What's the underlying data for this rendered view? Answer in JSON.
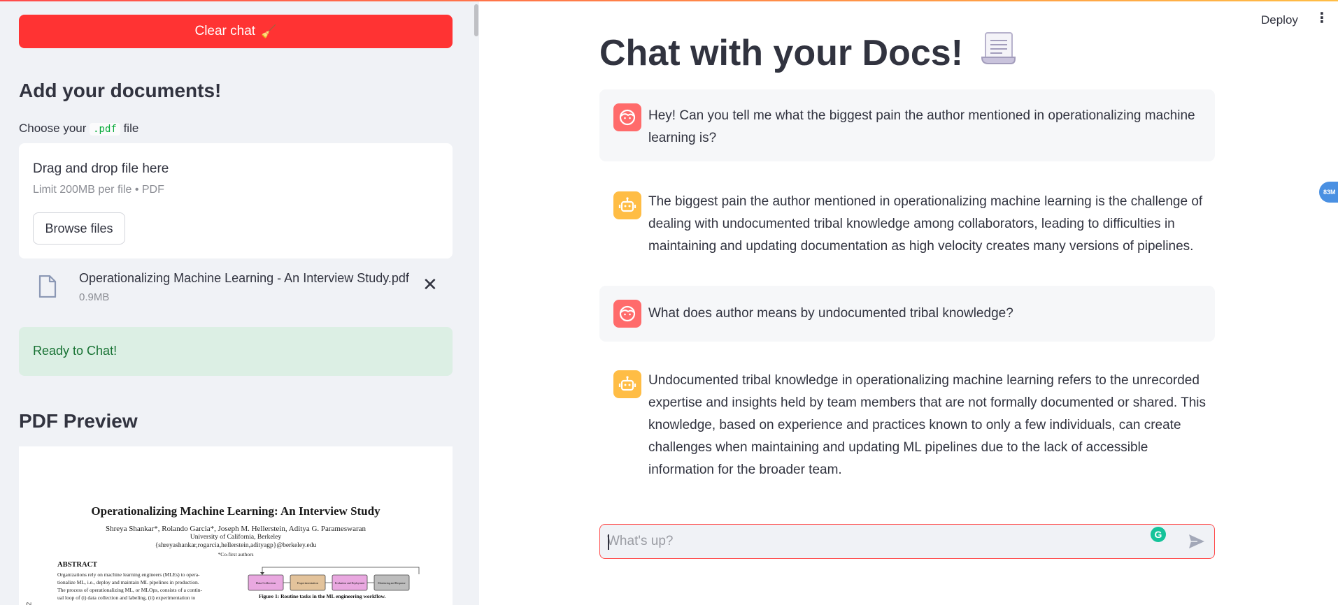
{
  "sidebar": {
    "clear_button": "Clear chat",
    "clear_button_icon": "🧹",
    "heading": "Add your documents!",
    "choose_prefix": "Choose your",
    "choose_code": ".pdf",
    "choose_suffix": "file",
    "dropzone": {
      "title": "Drag and drop file here",
      "subtitle": "Limit 200MB per file • PDF",
      "browse_button": "Browse files"
    },
    "uploaded_file": {
      "name": "Operationalizing Machine Learning - An Interview Study.pdf",
      "size": "0.9MB"
    },
    "status": "Ready to Chat!",
    "preview_heading": "PDF Preview",
    "pdf": {
      "title": "Operationalizing Machine Learning: An Interview Study",
      "authors": "Shreya Shankar*, Rolando Garcia*, Joseph M. Hellerstein, Aditya G. Parameswaran",
      "university": "University of California, Berkeley",
      "emails": "{shreyashankar,rogarcia,hellerstein,adityagp}@berkeley.edu",
      "cofirst": "*Co-first authors",
      "abstract_heading": "ABSTRACT",
      "abstract_lines": [
        "Organizations rely on machine learning engineers (MLEs) to opera-",
        "tionalize ML, i.e., deploy and maintain ML pipelines in production.",
        "The process of operationalizing ML, or MLOps, consists of a contin-",
        "ual loop of (i) data collection and labeling, (ii) experimentation to"
      ],
      "diagram_boxes": [
        "Data Collection",
        "Experimentation",
        "Evaluation and Deployment",
        "Monitoring and Response"
      ],
      "figure_caption": "Figure 1: Routine tasks in the ML engineering workflow.",
      "side_label": "2"
    }
  },
  "header": {
    "deploy": "Deploy",
    "menu": "⋮"
  },
  "main": {
    "title": "Chat with your Docs!",
    "messages": [
      {
        "role": "user",
        "text": "Hey! Can you tell me what the biggest pain the author mentioned in operationalizing machine learning is?"
      },
      {
        "role": "assistant",
        "text": "The biggest pain the author mentioned in operationalizing machine learning is the challenge of dealing with undocumented tribal knowledge among collaborators, leading to difficulties in maintaining and updating documentation as high velocity creates many versions of pipelines."
      },
      {
        "role": "user",
        "text": "What does author means by undocumented tribal knowledge?"
      },
      {
        "role": "assistant",
        "text": "Undocumented tribal knowledge in operationalizing machine learning refers to the unrecorded expertise and insights held by team members that are not formally documented or shared. This knowledge, based on experience and practices known to only a few individuals, can create challenges when maintaining and updating ML pipelines due to the lack of accessible information for the broader team."
      }
    ],
    "input_placeholder": "What's up?",
    "extension_badge": "83M"
  },
  "colors": {
    "primary": "#ff3333",
    "sidebar_bg": "#f0f2f6",
    "success_bg": "#dcefe4",
    "success_text": "#177233",
    "user_avatar": "#ff6b6b",
    "bot_avatar": "#ffbd45"
  }
}
